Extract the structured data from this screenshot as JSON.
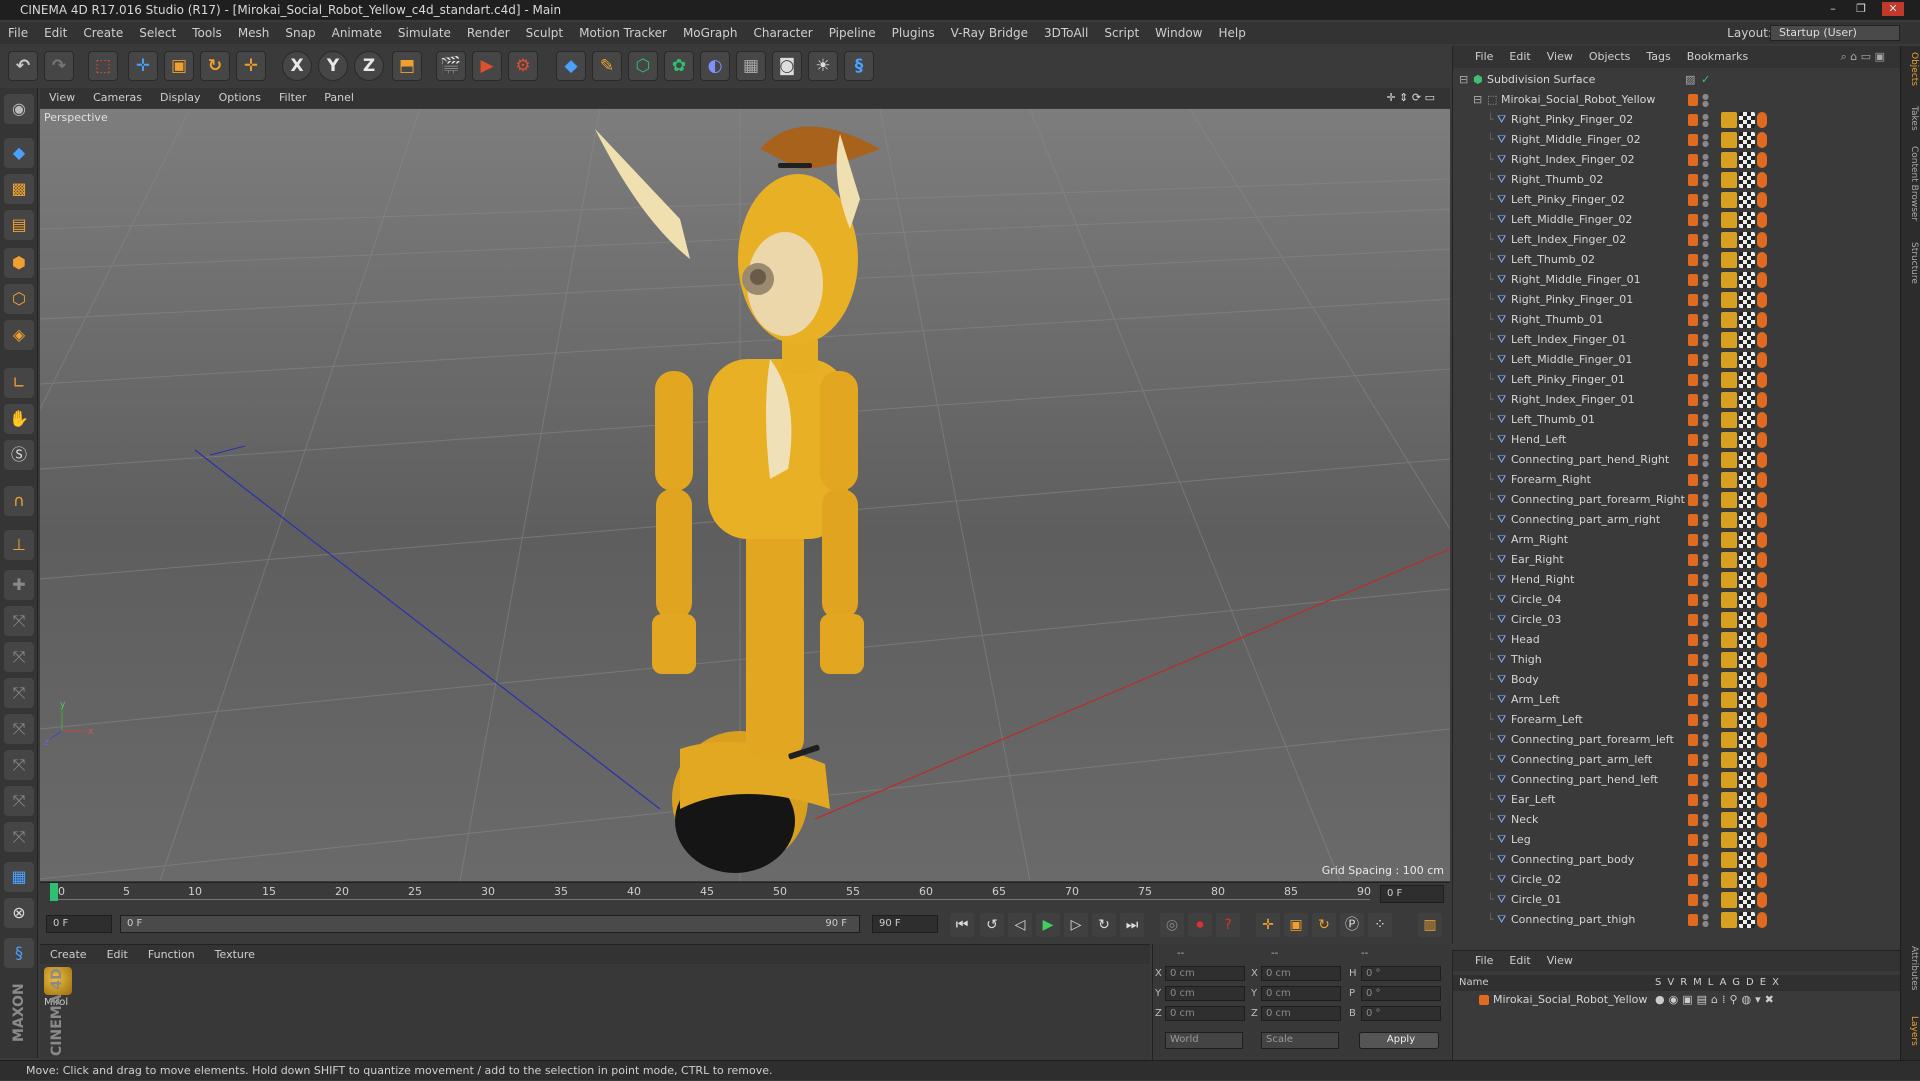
{
  "window": {
    "title": "CINEMA 4D R17.016 Studio (R17) - [Mirokai_Social_Robot_Yellow_c4d_standart.c4d] - Main",
    "controls": [
      "–",
      "❐",
      "✕"
    ]
  },
  "menubar": {
    "items": [
      "File",
      "Edit",
      "Create",
      "Select",
      "Tools",
      "Mesh",
      "Snap",
      "Animate",
      "Simulate",
      "Render",
      "Sculpt",
      "Motion Tracker",
      "MoGraph",
      "Character",
      "Pipeline",
      "Plugins",
      "V-Ray Bridge",
      "3DToAll",
      "Script",
      "Window",
      "Help"
    ],
    "layout_label": "Layout:",
    "layout_value": "Startup (User)"
  },
  "toolbar": {
    "icons": [
      "undo-icon",
      "redo-icon",
      "live-selection-icon",
      "move-icon",
      "scale-icon",
      "rotate-icon",
      "last-tool-icon",
      "x-axis-icon",
      "y-axis-icon",
      "z-axis-icon",
      "world-coordinates-icon",
      "render-view-icon",
      "render-picture-viewer-icon",
      "edit-render-settings-icon",
      "cube-icon",
      "pen-spline-icon",
      "subdivision-surface-icon",
      "array-icon",
      "deformer-icon",
      "floor-icon",
      "camera-icon",
      "light-icon",
      "python-icon"
    ],
    "axis_labels": [
      "X",
      "Y",
      "Z"
    ]
  },
  "viewport": {
    "menu": [
      "View",
      "Cameras",
      "Display",
      "Options",
      "Filter",
      "Panel"
    ],
    "camera_label": "Perspective",
    "grid_spacing": "Grid Spacing : 100 cm",
    "axis_labels": [
      "y",
      "x",
      "z"
    ]
  },
  "timeline": {
    "ticks": [
      "0",
      "5",
      "10",
      "15",
      "20",
      "25",
      "30",
      "35",
      "40",
      "45",
      "50",
      "55",
      "60",
      "65",
      "70",
      "75",
      "80",
      "85",
      "90"
    ],
    "current_frame_field": "0 F",
    "start_frame": "0 F",
    "range_start": "0 F",
    "range_end": "90 F",
    "end_frame": "90 F"
  },
  "material_manager": {
    "menu": [
      "Create",
      "Edit",
      "Function",
      "Texture"
    ],
    "materials": [
      "Mirol"
    ]
  },
  "coordinates": {
    "header": [
      "--",
      "--",
      "--"
    ],
    "rows": [
      {
        "axis": "X",
        "pos": "0 cm",
        "size_axis": "X",
        "size": "0 cm",
        "rot_axis": "H",
        "rot": "0 °"
      },
      {
        "axis": "Y",
        "pos": "0 cm",
        "size_axis": "Y",
        "size": "0 cm",
        "rot_axis": "P",
        "rot": "0 °"
      },
      {
        "axis": "Z",
        "pos": "0 cm",
        "size_axis": "Z",
        "size": "0 cm",
        "rot_axis": "B",
        "rot": "0 °"
      }
    ],
    "mode": "World",
    "scale_mode": "Scale",
    "apply_label": "Apply"
  },
  "object_manager": {
    "menu": [
      "File",
      "Edit",
      "View",
      "Objects",
      "Tags",
      "Bookmarks"
    ],
    "root": "Subdivision Surface",
    "group": "Mirokai_Social_Robot_Yellow",
    "objects": [
      "Right_Pinky_Finger_02",
      "Right_Middle_Finger_02",
      "Right_Index_Finger_02",
      "Right_Thumb_02",
      "Left_Pinky_Finger_02",
      "Left_Middle_Finger_02",
      "Left_Index_Finger_02",
      "Left_Thumb_02",
      "Right_Middle_Finger_01",
      "Right_Pinky_Finger_01",
      "Right_Thumb_01",
      "Left_Index_Finger_01",
      "Left_Middle_Finger_01",
      "Left_Pinky_Finger_01",
      "Right_Index_Finger_01",
      "Left_Thumb_01",
      "Hend_Left",
      "Connecting_part_hend_Right",
      "Forearm_Right",
      "Connecting_part_forearm_Right",
      "Connecting_part_arm_right",
      "Arm_Right",
      "Ear_Right",
      "Hend_Right",
      "Circle_04",
      "Circle_03",
      "Head",
      "Thigh",
      "Body",
      "Arm_Left",
      "Forearm_Left",
      "Connecting_part_forearm_left",
      "Connecting_part_arm_left",
      "Connecting_part_hend_left",
      "Ear_Left",
      "Neck",
      "Leg",
      "Connecting_part_body",
      "Circle_02",
      "Circle_01",
      "Connecting_part_thigh"
    ]
  },
  "layers": {
    "menu": [
      "File",
      "Edit",
      "View"
    ],
    "columns": [
      "Name",
      "S",
      "V",
      "R",
      "M",
      "L",
      "A",
      "G",
      "D",
      "E",
      "X"
    ],
    "rows": [
      "Mirokai_Social_Robot_Yellow"
    ]
  },
  "right_tabs": [
    "Objects",
    "Takes",
    "Content Browser",
    "Structure",
    "Attributes",
    "Layers"
  ],
  "brand": "MAXON CINEMA 4D",
  "status": "Move: Click and drag to move elements. Hold down SHIFT to quantize movement / add to the selection in point mode, CTRL to remove.",
  "colors": {
    "accent_orange": "#e06a20",
    "robot_yellow": "#e8b020",
    "x_axis": "#c03030",
    "z_axis": "#3040c0"
  }
}
